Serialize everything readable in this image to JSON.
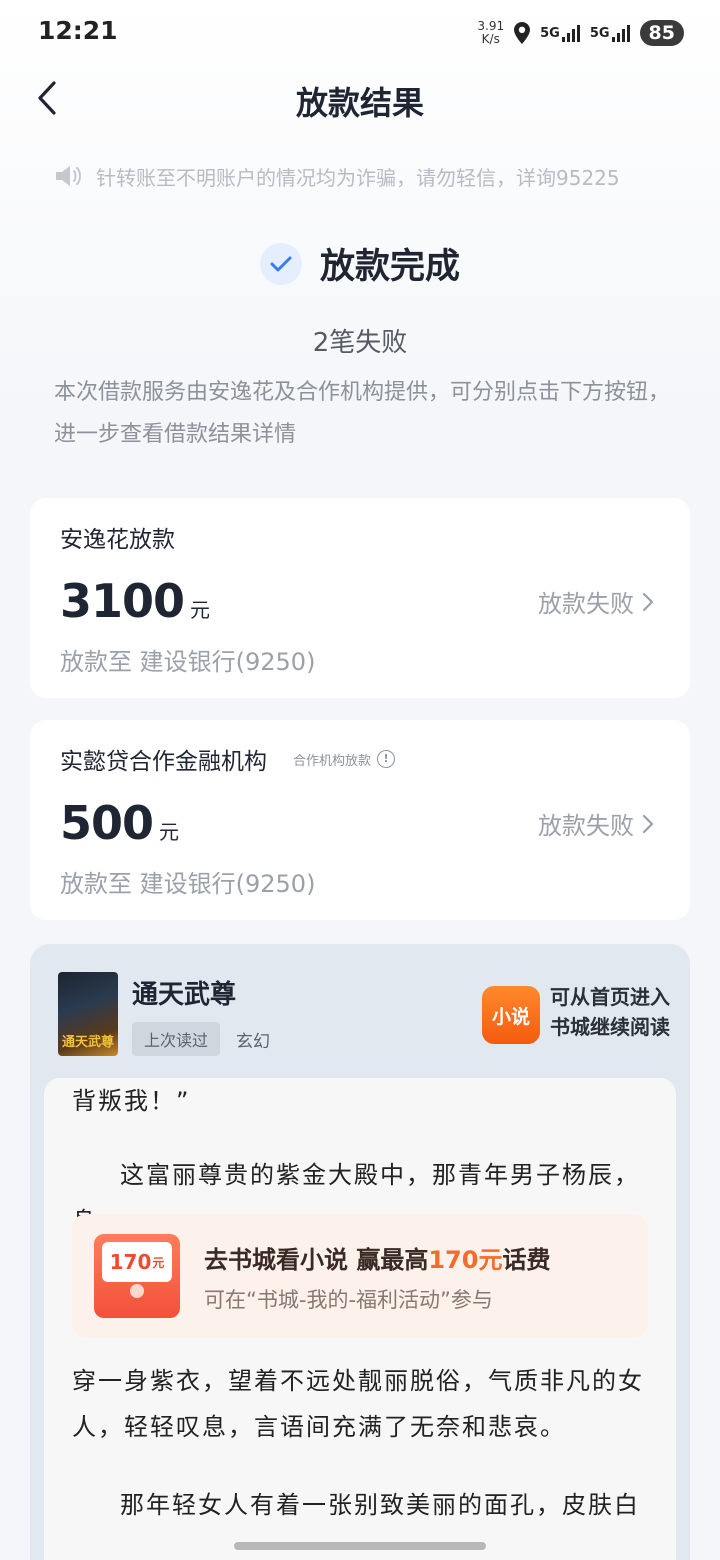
{
  "status_bar": {
    "time": "12:21",
    "net_speed_value": "3.91",
    "net_speed_unit": "K/s",
    "sim1": "5G",
    "sim2": "5G",
    "battery": "85"
  },
  "nav": {
    "title": "放款结果"
  },
  "notice": {
    "text": "针转账至不明账户的情况均为诈骗，请勿轻信，详询95225"
  },
  "result": {
    "title": "放款完成",
    "fail_count": "2笔失败",
    "description": "本次借款服务由安逸花及合作机构提供，可分别点击下方按钮，进一步查看借款结果详情"
  },
  "loans": [
    {
      "lender": "安逸花放款",
      "amount": "3100",
      "unit": "元",
      "status": "放款失败",
      "destination": "放款至 建设银行(9250)"
    },
    {
      "lender": "实懿贷合作金融机构",
      "sub_label": "合作机构放款",
      "amount": "500",
      "unit": "元",
      "status": "放款失败",
      "destination": "放款至 建设银行(9250)"
    }
  ],
  "novel": {
    "cover_text": "通天武尊",
    "book_title": "通天武尊",
    "tag_last_read": "上次读过",
    "genre": "玄幻",
    "app_icon_text": "小说",
    "hint_line1": "可从首页进入",
    "hint_line2": "书城继续阅读",
    "paragraphs": [
      "背叛我！”",
      "这富丽尊贵的紫金大殿中，那青年男子杨辰，身",
      "穿一身紫衣，望着不远处靓丽脱俗，气质非凡的女人，轻轻叹息，言语间充满了无奈和悲哀。",
      "那年轻女人有着一张别致美丽的面孔，皮肤白"
    ],
    "promo": {
      "coupon_value": "170",
      "coupon_unit": "元",
      "title_prefix": "去书城看小说 赢最高",
      "title_highlight": "170元",
      "title_suffix": "话费",
      "subtitle": "可在“书城-我的-福利活动”参与"
    }
  },
  "colors": {
    "accent_blue": "#3b7bf0",
    "promo_orange": "#f46b2a"
  }
}
